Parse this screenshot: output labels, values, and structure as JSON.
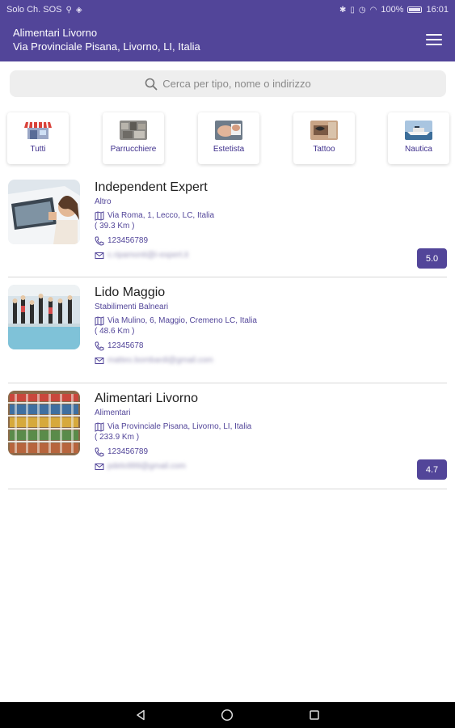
{
  "status_bar": {
    "carrier": "Solo Ch. SOS",
    "battery": "100%",
    "time": "16:01"
  },
  "header": {
    "title": "Alimentari Livorno",
    "subtitle": "Via Provinciale Pisana, Livorno, LI, Italia",
    "menu_icon": "hamburger-menu-icon"
  },
  "search": {
    "placeholder": "Cerca per tipo, nome o indirizzo",
    "icon": "search-icon"
  },
  "categories": [
    {
      "label": "Tutti",
      "icon": "storefront-icon"
    },
    {
      "label": "Parrucchiere",
      "icon": "hairdresser-photo"
    },
    {
      "label": "Estetista",
      "icon": "beautician-photo"
    },
    {
      "label": "Tattoo",
      "icon": "tattoo-photo"
    },
    {
      "label": "Nautica",
      "icon": "boat-photo"
    }
  ],
  "listings": [
    {
      "name": "Independent Expert",
      "category": "Altro",
      "address": "Via Roma, 1, Lecco, LC, Italia",
      "distance": "( 39.3 Km )",
      "phone": "123456789",
      "email": "c.ripamonti@i-expert.it",
      "rating": "5.0"
    },
    {
      "name": "Lido Maggio",
      "category": "Stabilimenti Balneari",
      "address": "Via Mulino, 6, Maggio, Cremeno LC, Italia",
      "distance": "( 48.6 Km )",
      "phone": "12345678",
      "email": "matteo.bombardi@gmail.com",
      "rating": ""
    },
    {
      "name": "Alimentari Livorno",
      "category": "Alimentari",
      "address": "Via Provinciale Pisana, Livorno, LI, Italia",
      "distance": "( 233.9 Km )",
      "phone": "123456789",
      "email": "pdelo999@gmail.com",
      "rating": "4.7"
    }
  ],
  "colors": {
    "primary": "#524599",
    "accent_text": "#3e2f8c",
    "divider": "#d8d8d8"
  }
}
